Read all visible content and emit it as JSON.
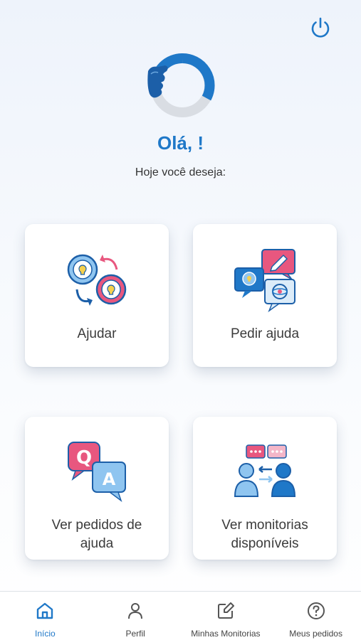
{
  "header": {
    "greeting": "Olá, !",
    "subtitle": "Hoje você deseja:",
    "power_icon": "power-icon"
  },
  "cards": [
    {
      "id": "ajudar",
      "label": "Ajudar",
      "icon": "lightbulb-exchange-icon"
    },
    {
      "id": "pedir-ajuda",
      "label": "Pedir ajuda",
      "icon": "chat-bubbles-icon"
    },
    {
      "id": "ver-pedidos",
      "label": "Ver pedidos de\najuda",
      "icon": "qa-bubbles-icon"
    },
    {
      "id": "ver-monitorias",
      "label": "Ver monitorias\ndisponíveis",
      "icon": "people-exchange-icon"
    }
  ],
  "nav": {
    "items": [
      {
        "label": "Início",
        "icon": "home-icon",
        "active": true
      },
      {
        "label": "Perfil",
        "icon": "user-icon",
        "active": false
      },
      {
        "label": "Minhas Monitorias",
        "icon": "edit-icon",
        "active": false
      },
      {
        "label": "Meus pedidos",
        "icon": "help-circle-icon",
        "active": false
      }
    ]
  },
  "colors": {
    "accent": "#1f78c8",
    "pink": "#e8577f",
    "light_blue": "#8fc5f0",
    "dark_blue": "#1c5fa8"
  }
}
